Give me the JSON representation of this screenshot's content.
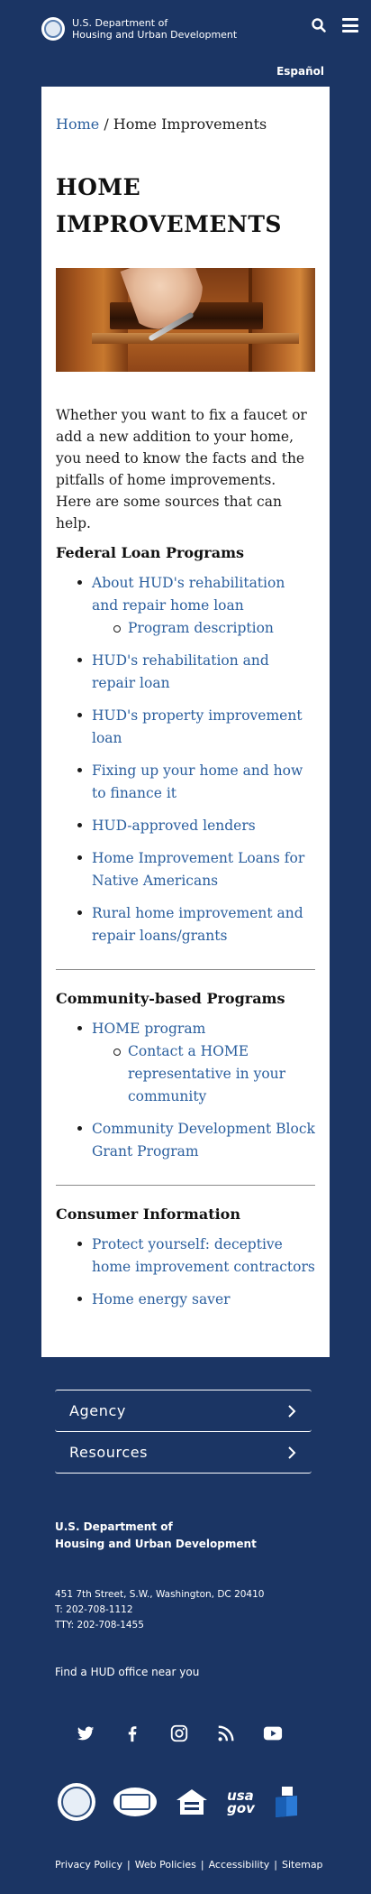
{
  "header": {
    "agency_line1": "U.S. Department of",
    "agency_line2": "Housing and Urban Development",
    "language_link": "Español"
  },
  "breadcrumb": {
    "home": "Home",
    "separator": " / ",
    "current": "Home Improvements"
  },
  "main": {
    "title": "HOME IMPROVEMENTS",
    "intro": "Whether you want to fix a faucet or add a new addition to your home, you need to know the facts and the pitfalls of home improvements. Here are some sources that can help.",
    "sections": [
      {
        "title": "Federal Loan Programs",
        "items": [
          {
            "label": "About HUD's rehabilitation and repair home loan",
            "sub": [
              "Program description"
            ]
          },
          {
            "label": "HUD's rehabilitation and repair loan"
          },
          {
            "label": "HUD's property improvement loan"
          },
          {
            "label": "Fixing up your home and how to finance it"
          },
          {
            "label": "HUD-approved lenders"
          },
          {
            "label": "Home Improvement Loans for Native Americans"
          },
          {
            "label": "Rural home improvement and repair loans/grants"
          }
        ]
      },
      {
        "title": "Community-based Programs",
        "items": [
          {
            "label": "HOME program",
            "sub": [
              "Contact a HOME representative in your community"
            ]
          },
          {
            "label": "Community Development Block Grant Program"
          }
        ]
      },
      {
        "title": "Consumer Information",
        "items": [
          {
            "label": "Protect yourself: deceptive home improvement contractors"
          },
          {
            "label": "Home energy saver"
          }
        ]
      }
    ]
  },
  "footer": {
    "accordion": [
      "Agency",
      "Resources"
    ],
    "org_line1": "U.S. Department of",
    "org_line2": "Housing and Urban Development",
    "address": "451 7th Street, S.W., Washington, DC 20410",
    "phone": "T: 202-708-1112",
    "tty": "TTY: 202-708-1455",
    "find_office": "Find a HUD office near you",
    "usa_gov_line1": "usa",
    "usa_gov_line2": "gov",
    "links": [
      "Privacy Policy",
      "Web Policies",
      "Accessibility",
      "Sitemap"
    ]
  },
  "colors": {
    "background": "#1b3564",
    "link": "#2b5f9e",
    "card": "#ffffff"
  }
}
